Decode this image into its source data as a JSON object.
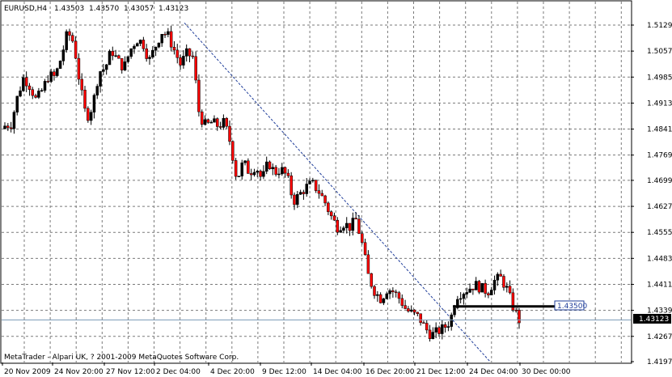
{
  "header": {
    "symbol": "EURUSD,H4",
    "open": "1.43503",
    "high": "1.43570",
    "low": "1.43057",
    "close": "1.43123"
  },
  "copyright": "MetaTrader - Alpari UK, ? 2001-2009 MetaQuotes Software Corp.",
  "price_axis": {
    "ticks": [
      "1.51290",
      "1.50570",
      "1.49850",
      "1.49130",
      "1.48410",
      "1.47690",
      "1.46990",
      "1.46270",
      "1.45550",
      "1.44830",
      "1.44110",
      "1.43390",
      "1.42670",
      "1.41970"
    ],
    "min": 1.4197,
    "max": 1.5129,
    "current_price": "1.43123",
    "line_label": "1.43500"
  },
  "time_axis": {
    "labels": [
      "20 Nov 2009",
      "24 Nov 20:00",
      "27 Nov 12:00",
      "2 Dec 04:00",
      "4 Dec 20:00",
      "9 Dec 12:00",
      "14 Dec 04:00",
      "16 Dec 20:00",
      "21 Dec 12:00",
      "24 Dec 04:00",
      "30 Dec 00:00"
    ]
  },
  "colors": {
    "bull": "#000000",
    "bear": "#ff0000",
    "grid": "#7a7a7a",
    "trendline": "#1f3d9a",
    "bid_line": "#7f9db9"
  },
  "chart_data": {
    "type": "candlestick",
    "title": "EURUSD,H4",
    "ylim": [
      1.4197,
      1.5129
    ],
    "x_labels": [
      "20 Nov 2009",
      "24 Nov 20:00",
      "27 Nov 12:00",
      "2 Dec 04:00",
      "4 Dec 20:00",
      "9 Dec 12:00",
      "14 Dec 04:00",
      "16 Dec 20:00",
      "21 Dec 12:00",
      "24 Dec 04:00",
      "30 Dec 00:00"
    ],
    "horizontal_line": 1.435,
    "trendline": {
      "from": 1.5135,
      "to": 1.4197
    },
    "last_price": 1.43123,
    "close_path": [
      1.485,
      1.4855,
      1.493,
      1.4985,
      1.496,
      1.492,
      1.495,
      1.499,
      1.4985,
      1.504,
      1.511,
      1.508,
      1.496,
      1.487,
      1.4905,
      1.5,
      1.501,
      1.506,
      1.503,
      1.501,
      1.506,
      1.509,
      1.508,
      1.503,
      1.507,
      1.511,
      1.51,
      1.506,
      1.502,
      1.505,
      1.504,
      1.488,
      1.485,
      1.486,
      1.485,
      1.486,
      1.48,
      1.47,
      1.475,
      1.472,
      1.474,
      1.47,
      1.475,
      1.472,
      1.473,
      1.471,
      1.464,
      1.466,
      1.468,
      1.469,
      1.467,
      1.464,
      1.46,
      1.457,
      1.458,
      1.457,
      1.459,
      1.452,
      1.443,
      1.439,
      1.437,
      1.44,
      1.439,
      1.437,
      1.434,
      1.433,
      1.432,
      1.429,
      1.427,
      1.428,
      1.429,
      1.431,
      1.438,
      1.439,
      1.44,
      1.441,
      1.44,
      1.439,
      1.442,
      1.443,
      1.44,
      1.435,
      1.4312
    ],
    "candle_count": 168
  }
}
